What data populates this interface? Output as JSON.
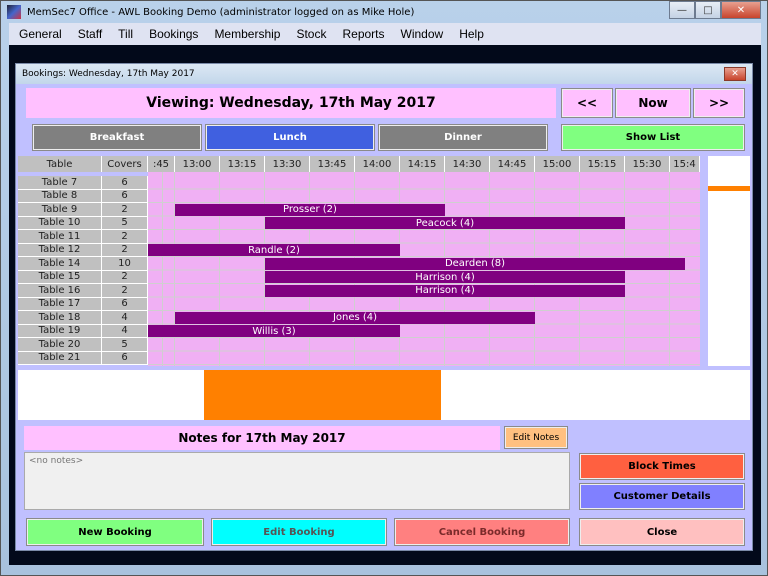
{
  "window": {
    "title": "MemSec7 Office - AWL Booking Demo (administrator logged on as Mike Hole)",
    "controls": {
      "minimize": "—",
      "maximize": "□",
      "close": "✕"
    }
  },
  "menu": [
    "General",
    "Staff",
    "Till",
    "Bookings",
    "Membership",
    "Stock",
    "Reports",
    "Window",
    "Help"
  ],
  "child": {
    "title": "Bookings: Wednesday, 17th May 2017",
    "close": "✕"
  },
  "header": {
    "viewing": "Viewing: Wednesday, 17th May 2017",
    "prev": "<<",
    "now": "Now",
    "next": ">>"
  },
  "meals": [
    {
      "label": "Breakfast",
      "color": "#808080",
      "text_color": "#ffffff"
    },
    {
      "label": "Lunch",
      "color": "#4060e0",
      "text_color": "#ffffff"
    },
    {
      "label": "Dinner",
      "color": "#808080",
      "text_color": "#ffffff"
    }
  ],
  "show_list": "Show List",
  "grid": {
    "col_table": "Table",
    "col_covers": "Covers",
    "times": [
      ":45",
      "13:00",
      "13:15",
      "13:30",
      "13:45",
      "14:00",
      "14:15",
      "14:30",
      "14:45",
      "15:00",
      "15:15",
      "15:30",
      "15:4"
    ],
    "rows": [
      {
        "table": "Table 7",
        "covers": "6"
      },
      {
        "table": "Table 8",
        "covers": "6"
      },
      {
        "table": "Table 9",
        "covers": "2"
      },
      {
        "table": "Table 10",
        "covers": "5"
      },
      {
        "table": "Table 11",
        "covers": "2"
      },
      {
        "table": "Table 12",
        "covers": "2"
      },
      {
        "table": "Table 14",
        "covers": "10"
      },
      {
        "table": "Table 15",
        "covers": "2"
      },
      {
        "table": "Table 16",
        "covers": "2"
      },
      {
        "table": "Table 17",
        "covers": "6"
      },
      {
        "table": "Table 18",
        "covers": "4"
      },
      {
        "table": "Table 19",
        "covers": "4"
      },
      {
        "table": "Table 20",
        "covers": "5"
      },
      {
        "table": "Table 21",
        "covers": "6"
      }
    ],
    "bookings": [
      {
        "row": 2,
        "label": "Prosser (2)",
        "start": "13:00",
        "end": "14:30"
      },
      {
        "row": 3,
        "label": "Peacock (4)",
        "start": "13:30",
        "end": "15:30"
      },
      {
        "row": 5,
        "label": "Randle (2)",
        "start": "12:45",
        "end": "14:15"
      },
      {
        "row": 6,
        "label": "Dearden (8)",
        "start": "13:30",
        "end": "15:50"
      },
      {
        "row": 7,
        "label": "Harrison (4)",
        "start": "13:30",
        "end": "15:30"
      },
      {
        "row": 8,
        "label": "Harrison (4)",
        "start": "13:30",
        "end": "15:30"
      },
      {
        "row": 10,
        "label": "Jones (4)",
        "start": "13:00",
        "end": "15:00"
      },
      {
        "row": 11,
        "label": "Willis (3)",
        "start": "12:45",
        "end": "14:15"
      }
    ],
    "bar_color": "#800080",
    "cell_color": "#f0b0f4"
  },
  "notes": {
    "title": "Notes for 17th May 2017",
    "edit": "Edit Notes",
    "placeholder": "<no notes>"
  },
  "actions": {
    "block_times": "Block Times",
    "customer_details": "Customer Details",
    "new_booking": "New Booking",
    "edit_booking": "Edit Booking",
    "cancel_booking": "Cancel Booking",
    "close": "Close"
  }
}
